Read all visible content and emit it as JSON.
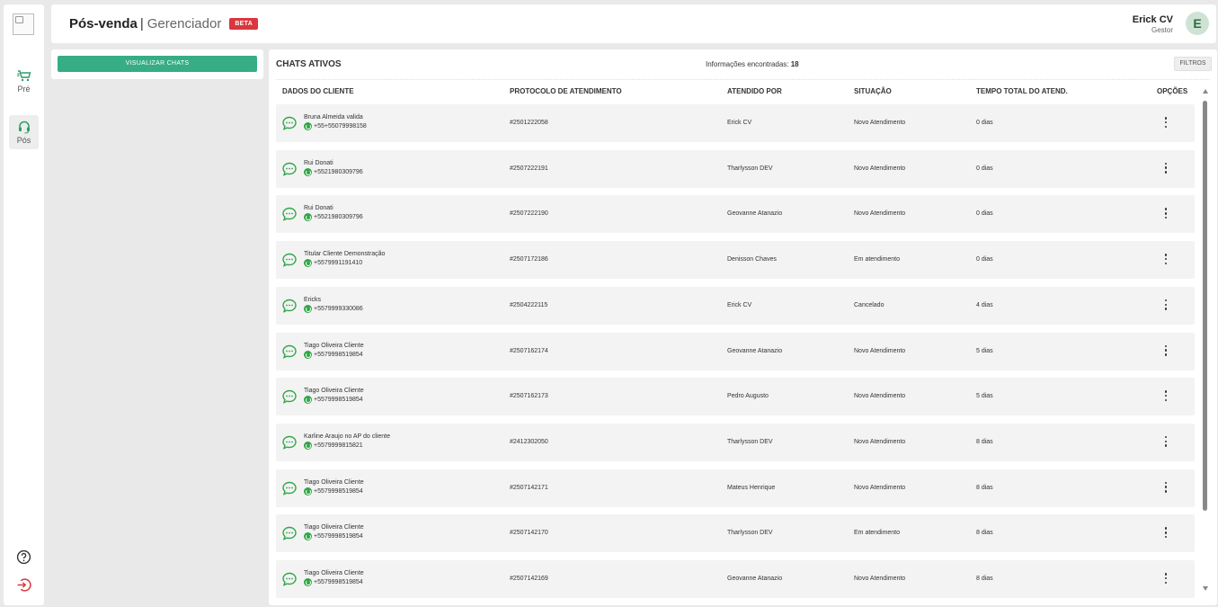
{
  "sidebar": {
    "items": [
      {
        "label": "Pré",
        "icon": "cart-icon"
      },
      {
        "label": "Pós",
        "icon": "headset-icon"
      }
    ],
    "bottom": [
      {
        "icon": "help-icon"
      },
      {
        "icon": "logout-icon"
      }
    ]
  },
  "header": {
    "title": "Pós-venda",
    "separator": "|",
    "subtitle": "Gerenciador",
    "badge": "BETA",
    "user_name": "Erick CV",
    "user_role": "Gestor",
    "avatar_initial": "E"
  },
  "side_panel": {
    "button": "VISUALIZAR CHATS"
  },
  "main": {
    "title": "CHATS ATIVOS",
    "found_label": "Informações encontradas:",
    "found_count": "18",
    "filters": "FILTROS"
  },
  "table": {
    "columns": [
      "DADOS DO CLIENTE",
      "PROTOCOLO DE ATENDIMENTO",
      "ATENDIDO POR",
      "SITUAÇÃO",
      "TEMPO TOTAL DO ATEND.",
      "OPÇÕES"
    ],
    "rows": [
      {
        "name": "Bruna Almeida valida",
        "phone": "+55+55079998158",
        "protocol": "#2501222058",
        "agent": "Erick CV",
        "status": "Novo Atendimento",
        "time": "0 dias"
      },
      {
        "name": "Rui Donati",
        "phone": "+5521980309796",
        "protocol": "#2507222191",
        "agent": "Tharlysson DEV",
        "status": "Novo Atendimento",
        "time": "0 dias"
      },
      {
        "name": "Rui Donati",
        "phone": "+5521980309796",
        "protocol": "#2507222190",
        "agent": "Geovanne Atanazio",
        "status": "Novo Atendimento",
        "time": "0 dias"
      },
      {
        "name": "Titular Cliente Demonstração",
        "phone": "+5579991191410",
        "protocol": "#2507172186",
        "agent": "Denisson Chaves",
        "status": "Em atendimento",
        "time": "0 dias"
      },
      {
        "name": "Ericks",
        "phone": "+5579999330086",
        "protocol": "#2504222115",
        "agent": "Erick CV",
        "status": "Cancelado",
        "time": "4 dias"
      },
      {
        "name": "Tiago Oliveira Cliente",
        "phone": "+5579998519854",
        "protocol": "#2507162174",
        "agent": "Geovanne Atanazio",
        "status": "Novo Atendimento",
        "time": "5 dias"
      },
      {
        "name": "Tiago Oliveira Cliente",
        "phone": "+5579998519854",
        "protocol": "#2507162173",
        "agent": "Pedro Augusto",
        "status": "Novo Atendimento",
        "time": "5 dias"
      },
      {
        "name": "Karline Araujo no AP do cliente",
        "phone": "+5579999815821",
        "protocol": "#2412302050",
        "agent": "Tharlysson DEV",
        "status": "Novo Atendimento",
        "time": "8 dias"
      },
      {
        "name": "Tiago Oliveira Cliente",
        "phone": "+5579998519854",
        "protocol": "#2507142171",
        "agent": "Mateus Henrique",
        "status": "Novo Atendimento",
        "time": "8 dias"
      },
      {
        "name": "Tiago Oliveira Cliente",
        "phone": "+5579998519854",
        "protocol": "#2507142170",
        "agent": "Tharlysson DEV",
        "status": "Em atendimento",
        "time": "8 dias"
      },
      {
        "name": "Tiago Oliveira Cliente",
        "phone": "+5579998519854",
        "protocol": "#2507142169",
        "agent": "Geovanne Atanazio",
        "status": "Novo Atendimento",
        "time": "8 dias"
      }
    ]
  },
  "colors": {
    "accent": "#36ad84",
    "badge": "#d9363e",
    "whatsapp": "#2fa647",
    "chat_icon": "#2fa647",
    "logout": "#d9363e"
  }
}
